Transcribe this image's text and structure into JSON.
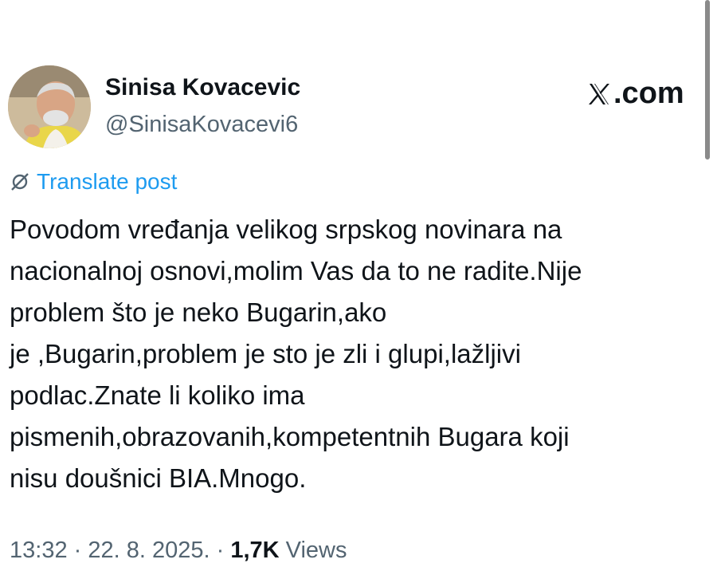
{
  "author": {
    "name": "Sinisa Kovacevic",
    "handle": "@SinisaKovacevi6"
  },
  "brand": {
    "text": ".com",
    "icon": "x-logo-icon"
  },
  "translate": {
    "label": "Translate post",
    "icon": "globe-slash-icon",
    "color": "#1d9bf0"
  },
  "post": {
    "lines": [
      "Povodom vređanja velikog srpskog novinara na",
      "nacionalnoj osnovi,molim Vas da to ne radite.Nije",
      "problem što je neko Bugarin,ako",
      "je ,Bugarin,problem je sto je zli i glupi,lažljivi",
      "podlac.Znate li koliko ima",
      "pismenih,obrazovanih,kompetentnih Bugara koji",
      "nisu doušnici BIA.Mnogo."
    ]
  },
  "meta": {
    "time": "13:32",
    "sep1": " · ",
    "date": "22. 8. 2025.",
    "sep2": " · ",
    "views_count": "1,7K",
    "views_label": " Views"
  }
}
